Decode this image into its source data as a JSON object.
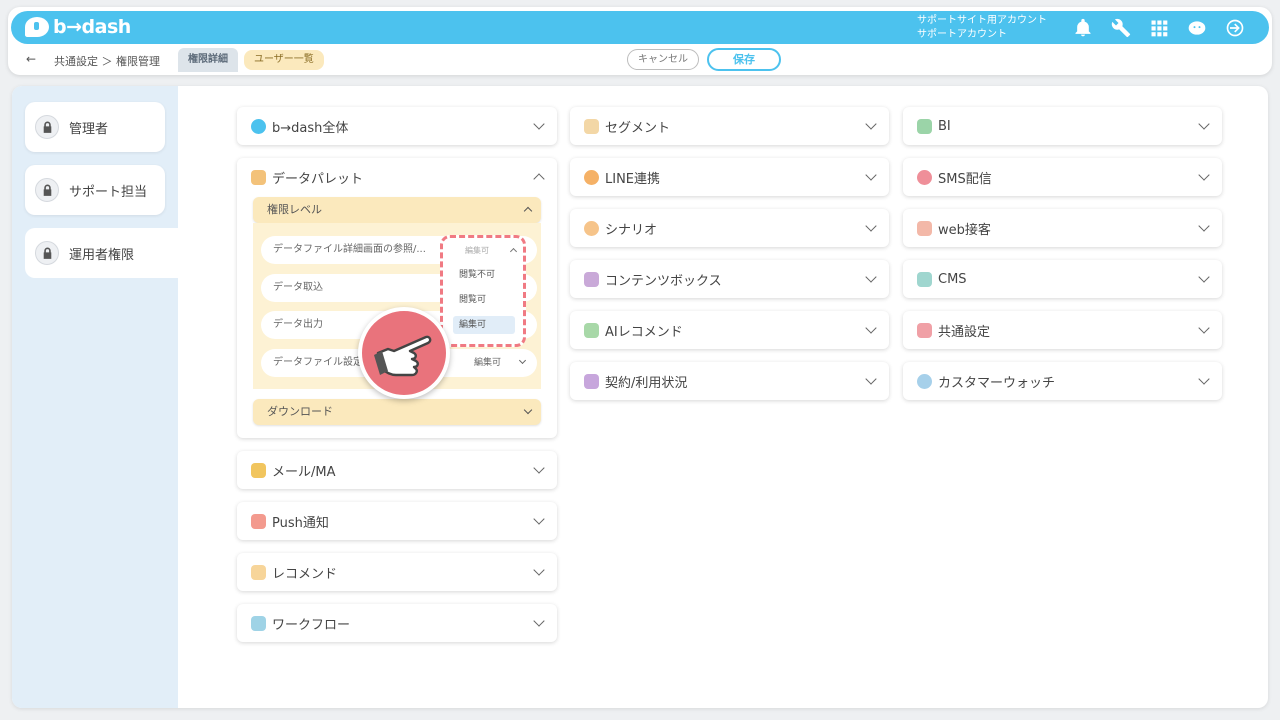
{
  "header": {
    "logo_text": "b→dash",
    "account_line1": "サポートサイト用アカウント",
    "account_line2": "サポートアカウント",
    "icons": [
      "bell-icon",
      "wrench-icon",
      "grid-icon",
      "bdash-bird-icon",
      "logout-icon"
    ]
  },
  "subbar": {
    "back": "←",
    "breadcrumb": "共通設定 ＞ 権限管理",
    "tab_detail": "権限詳細",
    "tab_users": "ユーザー一覧",
    "cancel": "キャンセル",
    "save": "保存"
  },
  "roles": [
    "管理者",
    "サポート担当",
    "運用者権限"
  ],
  "column1": {
    "bdash_all": "b→dash全体",
    "data_palette": "データパレット",
    "level_header": "権限レベル",
    "rows": [
      {
        "label": "データファイル詳細画面の参照/...",
        "value": "編集可"
      },
      {
        "label": "データ取込",
        "value": ""
      },
      {
        "label": "データ出力",
        "value": ""
      },
      {
        "label": "データファイル設定",
        "value": "編集可"
      }
    ],
    "download": "ダウンロード",
    "others": [
      "メール/MA",
      "Push通知",
      "レコメンド",
      "ワークフロー"
    ]
  },
  "dropdown": {
    "current": "編集可",
    "options": [
      "閲覧不可",
      "閲覧可",
      "編集可"
    ]
  },
  "column2": [
    "セグメント",
    "LINE連携",
    "シナリオ",
    "コンテンツボックス",
    "AIレコメンド",
    "契約/利用状況"
  ],
  "column3": [
    "BI",
    "SMS配信",
    "web接客",
    "CMS",
    "共通設定",
    "カスタマーウォッチ"
  ],
  "colors": {
    "accent": "#4cc2ee",
    "panel_yellow": "#fbe9bd",
    "highlight_red": "#f07a83"
  }
}
